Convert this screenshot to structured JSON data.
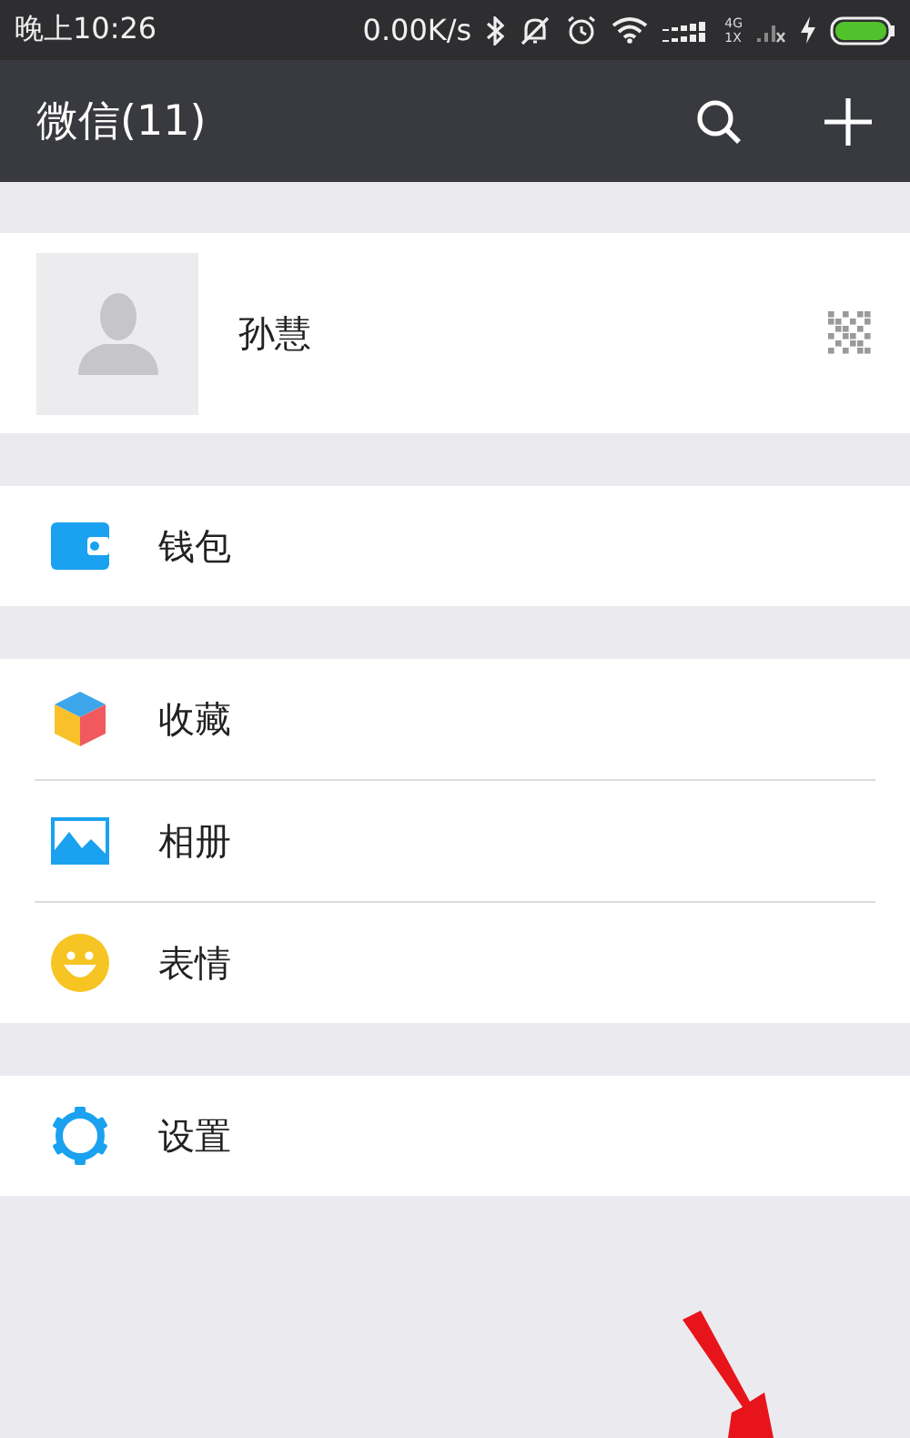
{
  "status_bar": {
    "time": "晚上10:26",
    "speed": "0.00K/s",
    "network_top": "4G",
    "network_bottom": "1X"
  },
  "header": {
    "title": "微信(11)"
  },
  "profile": {
    "name": "孙慧"
  },
  "groups": [
    {
      "items": [
        {
          "kind": "wallet",
          "label": "钱包"
        }
      ]
    },
    {
      "items": [
        {
          "kind": "favorites",
          "label": "收藏"
        },
        {
          "kind": "album",
          "label": "相册"
        },
        {
          "kind": "sticker",
          "label": "表情"
        }
      ]
    },
    {
      "items": [
        {
          "kind": "settings",
          "label": "设置"
        }
      ]
    }
  ]
}
